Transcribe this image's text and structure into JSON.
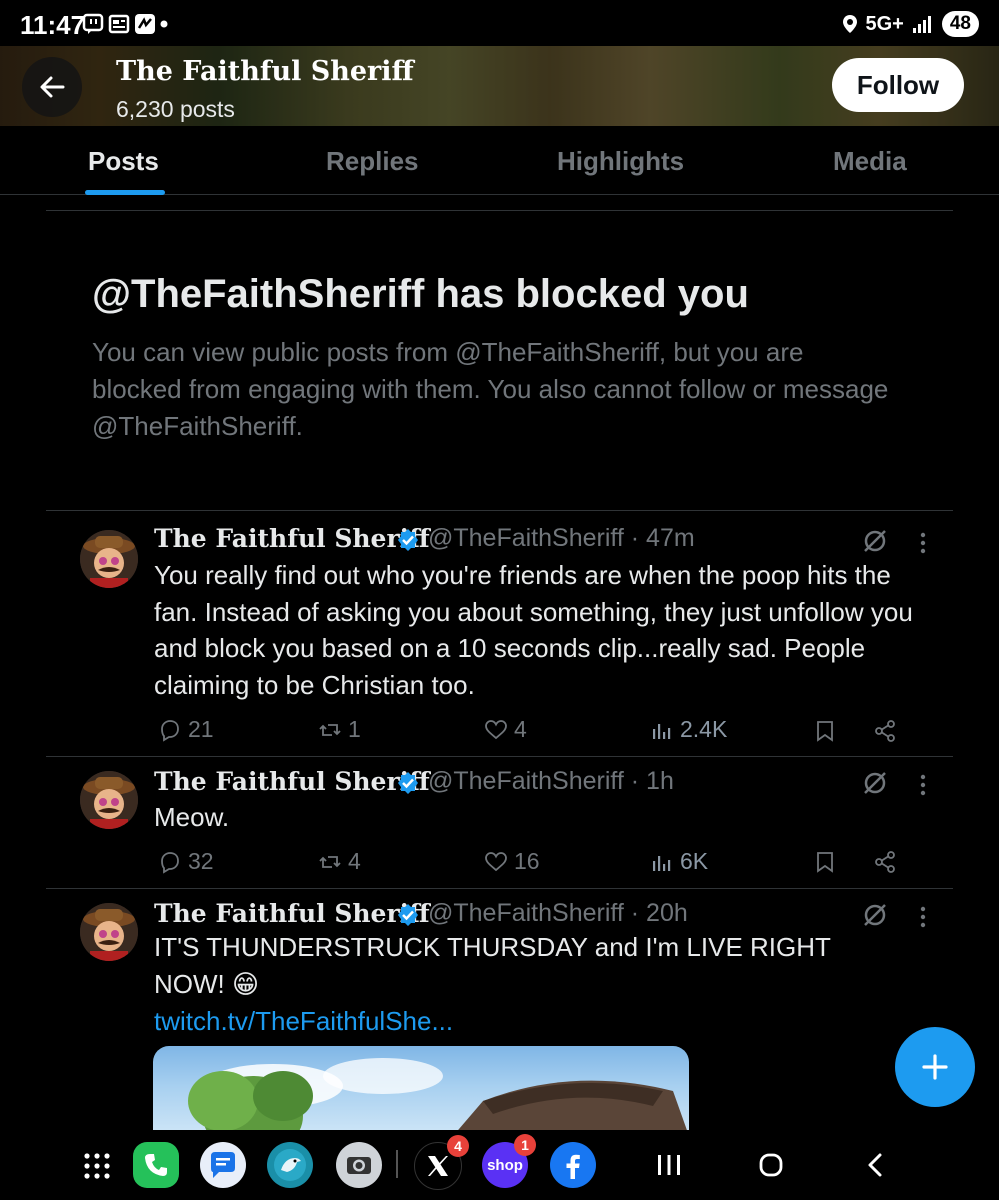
{
  "status_bar": {
    "time": "11:47",
    "network": "5G+",
    "battery": "48"
  },
  "header": {
    "title": "The Faithful Sheriff",
    "posts_count": "6,230 posts",
    "follow_label": "Follow"
  },
  "tabs": [
    {
      "label": "Posts",
      "active": true
    },
    {
      "label": "Replies",
      "active": false
    },
    {
      "label": "Highlights",
      "active": false
    },
    {
      "label": "Media",
      "active": false
    }
  ],
  "blocked_notice": {
    "title": "@TheFaithSheriff has blocked you",
    "description": "You can view public posts from @TheFaithSheriff, but you are blocked from engaging with them. You also cannot follow or message @TheFaithSheriff."
  },
  "posts": [
    {
      "name": "The Faithful Sheriff",
      "handle_time": "@TheFaithSheriff · 47m",
      "text": "You really find out who you're friends are when the poop hits the fan. Instead of asking you about something, they just unfollow you and block you based on a 10 seconds clip...really sad. People claiming to be Christian too.",
      "replies": "21",
      "reposts": "1",
      "likes": "4",
      "views": "2.4K"
    },
    {
      "name": "The Faithful Sheriff",
      "handle_time": "@TheFaithSheriff · 1h",
      "text": "Meow.",
      "replies": "32",
      "reposts": "4",
      "likes": "16",
      "views": "6K"
    },
    {
      "name": "The Faithful Sheriff",
      "handle_time": "@TheFaithSheriff · 20h",
      "text": "IT'S THUNDERSTRUCK THURSDAY and I'm LIVE RIGHT NOW! 😁",
      "link": "twitch.tv/TheFaithfulShe..."
    }
  ],
  "navbar": {
    "x_badge": "4",
    "shop_label": "shop",
    "shop_badge": "1"
  },
  "colors": {
    "accent": "#1d9bf0",
    "muted": "#71767b",
    "text": "#e7e9ea"
  }
}
